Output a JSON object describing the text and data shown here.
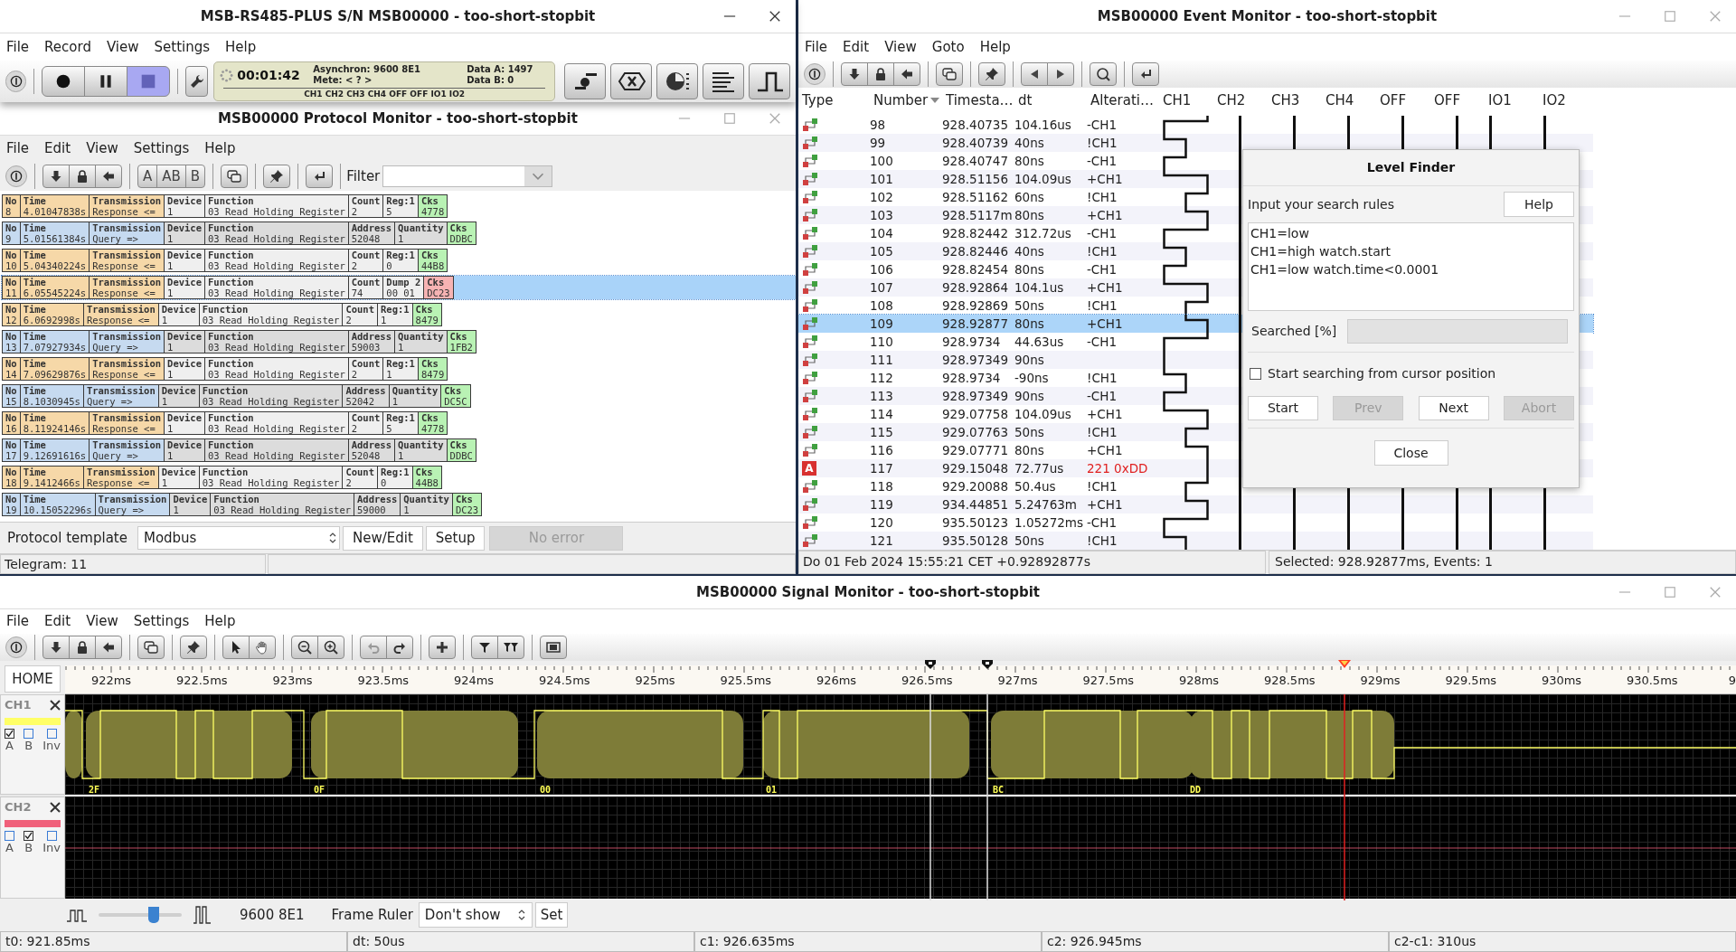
{
  "main_window": {
    "title": "MSB-RS485-PLUS S/N MSB00000 - too-short-stopbit",
    "menu": [
      "File",
      "Record",
      "View",
      "Settings",
      "Help"
    ],
    "transport": [
      {
        "kind": "record",
        "selected": false
      },
      {
        "kind": "pause",
        "selected": false
      },
      {
        "kind": "stop",
        "selected": true
      }
    ],
    "display": {
      "timer": "00:01:42",
      "mode": "Asynchron: 9600 8E1",
      "mete": "Mete: < ? >",
      "data_a": "Data A: 1497",
      "data_b": "Data B: 0",
      "channels": "CH1 CH2 CH3 CH4 OFF OFF IO1 IO2"
    }
  },
  "protocol_monitor": {
    "title": "MSB00000 Protocol Monitor - too-short-stopbit",
    "menu": [
      "File",
      "Edit",
      "View",
      "Settings",
      "Help"
    ],
    "view_buttons": [
      "A",
      "AB",
      "B"
    ],
    "filter_label": "Filter",
    "rows": [
      {
        "selected": false,
        "kind": "response",
        "checksum_ok": true,
        "cells": [
          {
            "label": "No",
            "value": "8"
          },
          {
            "label": "Time",
            "value": "4.01047838s"
          },
          {
            "label": "Transmission",
            "value": "Response <="
          },
          {
            "label": "Device",
            "value": "1"
          },
          {
            "label": "Function",
            "value": "03 Read Holding Register"
          },
          {
            "label": "Count",
            "value": "2"
          },
          {
            "label": "Reg:1",
            "value": "5"
          },
          {
            "label": "Cks",
            "value": "4778"
          }
        ]
      },
      {
        "selected": false,
        "kind": "query",
        "checksum_ok": true,
        "cells": [
          {
            "label": "No",
            "value": "9"
          },
          {
            "label": "Time",
            "value": "5.01561384s"
          },
          {
            "label": "Transmission",
            "value": "Query =>"
          },
          {
            "label": "Device",
            "value": "1"
          },
          {
            "label": "Function",
            "value": "03 Read Holding Register"
          },
          {
            "label": "Address",
            "value": "52048"
          },
          {
            "label": "Quantity",
            "value": "1"
          },
          {
            "label": "Cks",
            "value": "DDBC"
          }
        ]
      },
      {
        "selected": false,
        "kind": "response",
        "checksum_ok": true,
        "cells": [
          {
            "label": "No",
            "value": "10"
          },
          {
            "label": "Time",
            "value": "5.04340224s"
          },
          {
            "label": "Transmission",
            "value": "Response <="
          },
          {
            "label": "Device",
            "value": "1"
          },
          {
            "label": "Function",
            "value": "03 Read Holding Register"
          },
          {
            "label": "Count",
            "value": "2"
          },
          {
            "label": "Reg:1",
            "value": "0"
          },
          {
            "label": "Cks",
            "value": "44B8"
          }
        ]
      },
      {
        "selected": true,
        "kind": "response",
        "checksum_ok": false,
        "cells": [
          {
            "label": "No",
            "value": "11"
          },
          {
            "label": "Time",
            "value": "6.05545224s"
          },
          {
            "label": "Transmission",
            "value": "Response <="
          },
          {
            "label": "Device",
            "value": "1"
          },
          {
            "label": "Function",
            "value": "03 Read Holding Register"
          },
          {
            "label": "Count",
            "value": "74"
          },
          {
            "label": "Dump 2",
            "value": "00 01"
          },
          {
            "label": "Cks",
            "value": "DC23"
          }
        ]
      },
      {
        "selected": false,
        "kind": "response",
        "checksum_ok": true,
        "cells": [
          {
            "label": "No",
            "value": "12"
          },
          {
            "label": "Time",
            "value": "6.0692998s"
          },
          {
            "label": "Transmission",
            "value": "Response <="
          },
          {
            "label": "Device",
            "value": "1"
          },
          {
            "label": "Function",
            "value": "03 Read Holding Register"
          },
          {
            "label": "Count",
            "value": "2"
          },
          {
            "label": "Reg:1",
            "value": "1"
          },
          {
            "label": "Cks",
            "value": "8479"
          }
        ]
      },
      {
        "selected": false,
        "kind": "query",
        "checksum_ok": true,
        "cells": [
          {
            "label": "No",
            "value": "13"
          },
          {
            "label": "Time",
            "value": "7.07927934s"
          },
          {
            "label": "Transmission",
            "value": "Query =>"
          },
          {
            "label": "Device",
            "value": "1"
          },
          {
            "label": "Function",
            "value": "03 Read Holding Register"
          },
          {
            "label": "Address",
            "value": "59003"
          },
          {
            "label": "Quantity",
            "value": "1"
          },
          {
            "label": "Cks",
            "value": "1FB2"
          }
        ]
      },
      {
        "selected": false,
        "kind": "response",
        "checksum_ok": true,
        "cells": [
          {
            "label": "No",
            "value": "14"
          },
          {
            "label": "Time",
            "value": "7.09629876s"
          },
          {
            "label": "Transmission",
            "value": "Response <="
          },
          {
            "label": "Device",
            "value": "1"
          },
          {
            "label": "Function",
            "value": "03 Read Holding Register"
          },
          {
            "label": "Count",
            "value": "2"
          },
          {
            "label": "Reg:1",
            "value": "1"
          },
          {
            "label": "Cks",
            "value": "8479"
          }
        ]
      },
      {
        "selected": false,
        "kind": "query",
        "checksum_ok": true,
        "cells": [
          {
            "label": "No",
            "value": "15"
          },
          {
            "label": "Time",
            "value": "8.1030945s"
          },
          {
            "label": "Transmission",
            "value": "Query =>"
          },
          {
            "label": "Device",
            "value": "1"
          },
          {
            "label": "Function",
            "value": "03 Read Holding Register"
          },
          {
            "label": "Address",
            "value": "52042"
          },
          {
            "label": "Quantity",
            "value": "1"
          },
          {
            "label": "Cks",
            "value": "DC5C"
          }
        ]
      },
      {
        "selected": false,
        "kind": "response",
        "checksum_ok": true,
        "cells": [
          {
            "label": "No",
            "value": "16"
          },
          {
            "label": "Time",
            "value": "8.11924146s"
          },
          {
            "label": "Transmission",
            "value": "Response <="
          },
          {
            "label": "Device",
            "value": "1"
          },
          {
            "label": "Function",
            "value": "03 Read Holding Register"
          },
          {
            "label": "Count",
            "value": "2"
          },
          {
            "label": "Reg:1",
            "value": "5"
          },
          {
            "label": "Cks",
            "value": "4778"
          }
        ]
      },
      {
        "selected": false,
        "kind": "query",
        "checksum_ok": true,
        "cells": [
          {
            "label": "No",
            "value": "17"
          },
          {
            "label": "Time",
            "value": "9.12691616s"
          },
          {
            "label": "Transmission",
            "value": "Query =>"
          },
          {
            "label": "Device",
            "value": "1"
          },
          {
            "label": "Function",
            "value": "03 Read Holding Register"
          },
          {
            "label": "Address",
            "value": "52048"
          },
          {
            "label": "Quantity",
            "value": "1"
          },
          {
            "label": "Cks",
            "value": "DDBC"
          }
        ]
      },
      {
        "selected": false,
        "kind": "response",
        "checksum_ok": true,
        "cells": [
          {
            "label": "No",
            "value": "18"
          },
          {
            "label": "Time",
            "value": "9.1412466s"
          },
          {
            "label": "Transmission",
            "value": "Response <="
          },
          {
            "label": "Device",
            "value": "1"
          },
          {
            "label": "Function",
            "value": "03 Read Holding Register"
          },
          {
            "label": "Count",
            "value": "2"
          },
          {
            "label": "Reg:1",
            "value": "0"
          },
          {
            "label": "Cks",
            "value": "44B8"
          }
        ]
      },
      {
        "selected": false,
        "kind": "query",
        "checksum_ok": true,
        "cells": [
          {
            "label": "No",
            "value": "19"
          },
          {
            "label": "Time",
            "value": "10.15052296s"
          },
          {
            "label": "Transmission",
            "value": "Query =>"
          },
          {
            "label": "Device",
            "value": "1"
          },
          {
            "label": "Function",
            "value": "03 Read Holding Register"
          },
          {
            "label": "Address",
            "value": "59000"
          },
          {
            "label": "Quantity",
            "value": "1"
          },
          {
            "label": "Cks",
            "value": "DC23"
          }
        ]
      }
    ],
    "template_label": "Protocol template",
    "template": "Modbus",
    "buttons": [
      {
        "label": "New/Edit",
        "disabled": false
      },
      {
        "label": "Setup",
        "disabled": false
      },
      {
        "label": "No error",
        "disabled": true
      }
    ],
    "status": "Telegram: 11"
  },
  "event_monitor": {
    "title": "MSB00000 Event Monitor - too-short-stopbit",
    "menu": [
      "File",
      "Edit",
      "View",
      "Goto",
      "Help"
    ],
    "columns": [
      {
        "label": "Type",
        "sorted": false
      },
      {
        "label": "Number",
        "sorted": true
      },
      {
        "label": "Timesta…",
        "sorted": false
      },
      {
        "label": "dt",
        "sorted": false
      },
      {
        "label": "Alterati…",
        "sorted": false
      },
      {
        "label": "CH1",
        "sorted": false
      },
      {
        "label": "CH2",
        "sorted": false,
        "line_centered": true
      },
      {
        "label": "CH3",
        "sorted": false,
        "line_centered": true
      },
      {
        "label": "CH4",
        "sorted": false,
        "line_centered": true
      },
      {
        "label": "OFF",
        "sorted": false,
        "line_centered": true
      },
      {
        "label": "OFF",
        "sorted": false,
        "line_centered": true
      },
      {
        "label": "IO1",
        "sorted": false,
        "line_centered": false
      },
      {
        "label": "IO2",
        "sorted": false,
        "line_centered": false
      }
    ],
    "rows": [
      {
        "kind": "edge",
        "number": "98",
        "timestamp": "928.40735",
        "dt": "104.16us",
        "alteration": "-CH1",
        "ch1_high": false,
        "selected": false
      },
      {
        "kind": "glitch",
        "number": "99",
        "timestamp": "928.40739",
        "dt": "40ns",
        "alteration": "!CH1",
        "selected": false
      },
      {
        "kind": "edge",
        "number": "100",
        "timestamp": "928.40747",
        "dt": "80ns",
        "alteration": "-CH1",
        "ch1_high": false,
        "selected": false
      },
      {
        "kind": "edge",
        "number": "101",
        "timestamp": "928.51156",
        "dt": "104.09us",
        "alteration": "+CH1",
        "ch1_high": true,
        "selected": false
      },
      {
        "kind": "glitch",
        "number": "102",
        "timestamp": "928.51162",
        "dt": "60ns",
        "alteration": "!CH1",
        "selected": false
      },
      {
        "kind": "edge",
        "number": "103",
        "timestamp": "928.5117m",
        "dt": "80ns",
        "alteration": "+CH1",
        "ch1_high": true,
        "selected": false
      },
      {
        "kind": "edge",
        "number": "104",
        "timestamp": "928.82442",
        "dt": "312.72us",
        "alteration": "-CH1",
        "ch1_high": false,
        "selected": false
      },
      {
        "kind": "glitch",
        "number": "105",
        "timestamp": "928.82446",
        "dt": "40ns",
        "alteration": "!CH1",
        "selected": false
      },
      {
        "kind": "edge",
        "number": "106",
        "timestamp": "928.82454",
        "dt": "80ns",
        "alteration": "-CH1",
        "ch1_high": false,
        "selected": false
      },
      {
        "kind": "edge",
        "number": "107",
        "timestamp": "928.92864",
        "dt": "104.1us",
        "alteration": "+CH1",
        "ch1_high": true,
        "selected": false
      },
      {
        "kind": "glitch",
        "number": "108",
        "timestamp": "928.92869",
        "dt": "50ns",
        "alteration": "!CH1",
        "selected": false
      },
      {
        "kind": "edge",
        "number": "109",
        "timestamp": "928.92877",
        "dt": "80ns",
        "alteration": "+CH1",
        "ch1_high": true,
        "selected": true
      },
      {
        "kind": "edge",
        "number": "110",
        "timestamp": "928.9734",
        "dt": "44.63us",
        "alteration": "-CH1",
        "ch1_high": false,
        "selected": false
      },
      {
        "kind": "edge",
        "number": "111",
        "timestamp": "928.97349",
        "dt": "90ns",
        "selected": false
      },
      {
        "kind": "glitch",
        "number": "112",
        "timestamp": "928.9734",
        "dt": "-90ns",
        "alteration": "!CH1",
        "selected": false
      },
      {
        "kind": "edge",
        "number": "113",
        "timestamp": "928.97349",
        "dt": "90ns",
        "alteration": "-CH1",
        "ch1_high": false,
        "selected": false
      },
      {
        "kind": "edge",
        "number": "114",
        "timestamp": "929.07758",
        "dt": "104.09us",
        "alteration": "+CH1",
        "ch1_high": true,
        "selected": false
      },
      {
        "kind": "glitch",
        "number": "115",
        "timestamp": "929.07763",
        "dt": "50ns",
        "alteration": "!CH1",
        "selected": false
      },
      {
        "kind": "edge",
        "number": "116",
        "timestamp": "929.07771",
        "dt": "80ns",
        "alteration": "+CH1",
        "ch1_high": true,
        "selected": false
      },
      {
        "kind": "data",
        "type_label": "A",
        "number": "117",
        "timestamp": "929.15048",
        "dt": "72.77us",
        "alteration": "221 0xDD",
        "selected": false
      },
      {
        "kind": "glitch",
        "number": "118",
        "timestamp": "929.20088",
        "dt": "50.4us",
        "alteration": "!CH1",
        "selected": false
      },
      {
        "kind": "edge",
        "number": "119",
        "timestamp": "934.44851",
        "dt": "5.24763m",
        "alteration": "+CH1",
        "ch1_high": true,
        "selected": false
      },
      {
        "kind": "edge",
        "number": "120",
        "timestamp": "935.50123",
        "dt": "1.05272ms",
        "alteration": "-CH1",
        "ch1_high": false,
        "selected": false
      },
      {
        "kind": "glitch",
        "number": "121",
        "timestamp": "935.50128",
        "dt": "50ns",
        "alteration": "!CH1",
        "selected": false
      }
    ],
    "status_left": "Do 01 Feb 2024 15:55:21 CET +0.92892877s",
    "status_right": "Selected: 928.92877ms, Events: 1"
  },
  "level_finder": {
    "title": "Level Finder",
    "prompt": "Input your search rules",
    "help": "Help",
    "rules": [
      "CH1=low",
      "CH1=high watch.start",
      "CH1=low watch.time<0.0001"
    ],
    "progress_label": "Searched [%]",
    "progress": {
      "level": 0
    },
    "from_cursor": {
      "label": "Start searching from cursor position",
      "checked": false
    },
    "buttons": [
      {
        "label": "Start",
        "disabled": false
      },
      {
        "label": "Prev",
        "disabled": true
      },
      {
        "label": "Next",
        "disabled": false
      },
      {
        "label": "Abort",
        "disabled": true
      }
    ],
    "close": "Close"
  },
  "signal_monitor": {
    "title": "MSB00000 Signal Monitor - too-short-stopbit",
    "menu": [
      "File",
      "Edit",
      "View",
      "Settings",
      "Help"
    ],
    "home": "HOME",
    "ruler": [
      "922ms",
      "922.5ms",
      "923ms",
      "923.5ms",
      "924ms",
      "924.5ms",
      "925ms",
      "925.5ms",
      "926ms",
      "926.5ms",
      "927ms",
      "927.5ms",
      "928ms",
      "928.5ms",
      "929ms",
      "929.5ms",
      "930ms",
      "930.5ms",
      "9"
    ],
    "channels": [
      {
        "name": "CH1",
        "color": "#ffff66",
        "checks": [
          {
            "label": "A",
            "checked": true
          },
          {
            "label": "B",
            "checked": false
          },
          {
            "label": "Inv",
            "checked": false
          }
        ],
        "frames": [
          "2F",
          "0F",
          "00",
          "01",
          "BC",
          "DD"
        ]
      },
      {
        "name": "CH2",
        "color": "#f0607a",
        "checks": [
          {
            "label": "A",
            "checked": false
          },
          {
            "label": "B",
            "checked": true
          },
          {
            "label": "Inv",
            "checked": false
          }
        ]
      }
    ],
    "speed": {
      "level": 0.66
    },
    "baud": "9600 8E1",
    "frame_ruler_label": "Frame Ruler",
    "frame_ruler": "Don't show",
    "set": "Set",
    "status": [
      "t0: 921.85ms",
      "dt: 50us",
      "c1: 926.635ms",
      "c2: 926.945ms",
      "c2-c1: 310us"
    ]
  }
}
